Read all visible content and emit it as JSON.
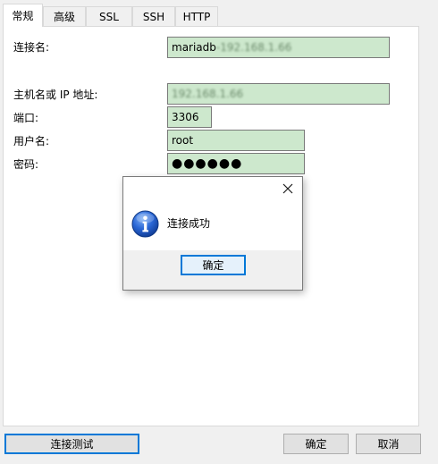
{
  "tabs": [
    {
      "label": "常规",
      "active": true
    },
    {
      "label": "高级",
      "active": false
    },
    {
      "label": "SSL",
      "active": false
    },
    {
      "label": "SSH",
      "active": false
    },
    {
      "label": "HTTP",
      "active": false
    }
  ],
  "form": {
    "connection_name_label": "连接名:",
    "connection_name_value": "mariadb",
    "connection_name_blurred": "-192.168.1.66",
    "host_label": "主机名或 IP 地址:",
    "host_value": "192.168.1.66",
    "port_label": "端口:",
    "port_value": "3306",
    "username_label": "用户名:",
    "username_value": "root",
    "password_label": "密码:",
    "password_value": "●●●●●●"
  },
  "dialog": {
    "message": "连接成功",
    "ok_label": "确定",
    "icon": "info-icon"
  },
  "buttons": {
    "test_connection": "连接测试",
    "ok": "确定",
    "cancel": "取消"
  },
  "colors": {
    "field_bg": "#cde8cd",
    "accent": "#0078d7",
    "info_icon_blue": "#1e5bc6"
  }
}
